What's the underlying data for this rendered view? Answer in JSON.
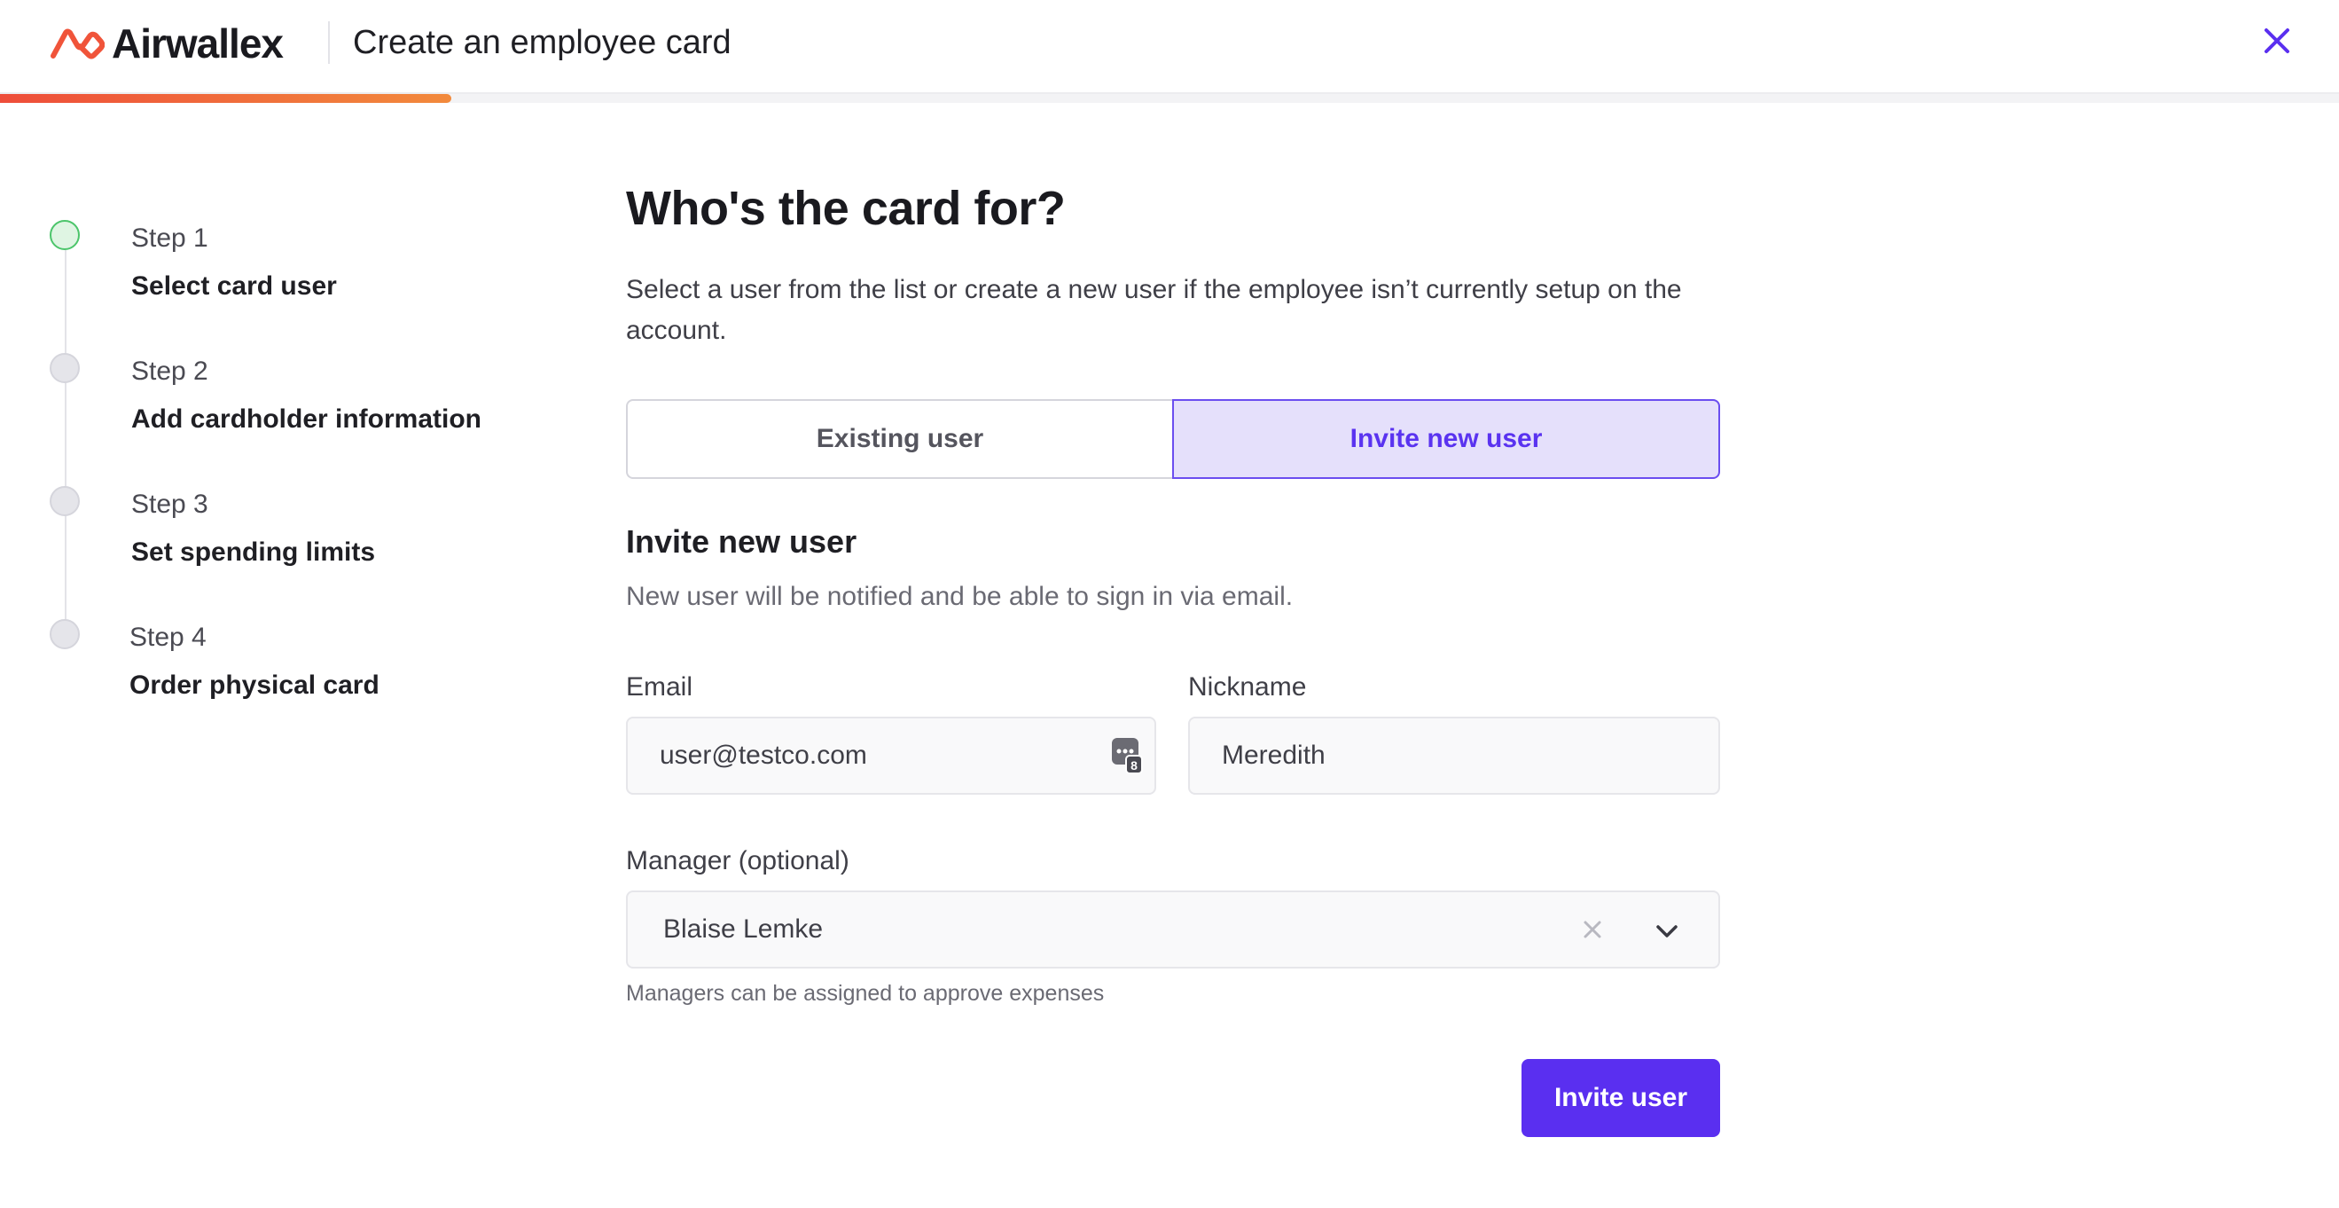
{
  "header": {
    "brand": "Airwallex",
    "title": "Create an employee card",
    "close_icon": "close-icon",
    "progress_percent": 19.3
  },
  "colors": {
    "accent": "#5a2ff0",
    "accent_light": "#e5e0fb",
    "brand_orange": "#f0543a",
    "step_active": "#4cc56b"
  },
  "stepper": {
    "steps": [
      {
        "number": "Step 1",
        "label": "Select card user",
        "status": "active"
      },
      {
        "number": "Step 2",
        "label": "Add cardholder information",
        "status": "pending"
      },
      {
        "number": "Step 3",
        "label": "Set spending limits",
        "status": "pending"
      },
      {
        "number": "Step 4",
        "label": "Order physical card",
        "status": "pending"
      }
    ]
  },
  "main": {
    "title": "Who's the card for?",
    "description": "Select a user from the list or create a new user if the employee isn’t currently setup on the account.",
    "toggle": {
      "existing_label": "Existing user",
      "invite_label": "Invite new user",
      "selected": "Invite new user"
    },
    "section_title": "Invite new user",
    "section_desc": "New user will be notified and be able to sign in via email.",
    "email": {
      "label": "Email",
      "value": "user@testco.com",
      "icon": "password-manager-icon"
    },
    "nickname": {
      "label": "Nickname",
      "value": "Meredith"
    },
    "manager": {
      "label": "Manager (optional)",
      "value": "Blaise Lemke",
      "helper": "Managers can be assigned to approve expenses",
      "clear_icon": "clear-icon",
      "chevron_icon": "chevron-down-icon"
    },
    "submit_label": "Invite user"
  }
}
